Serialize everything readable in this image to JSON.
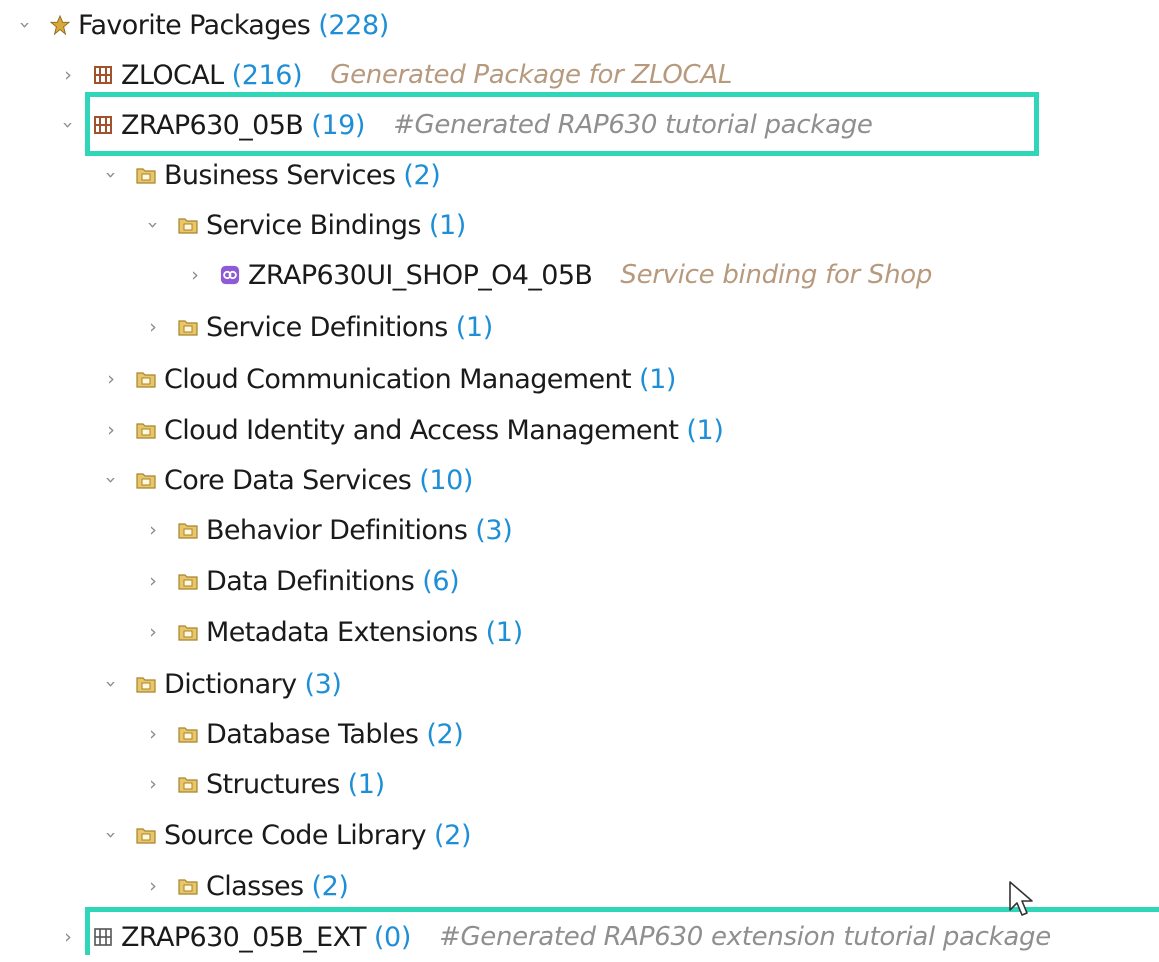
{
  "tree": {
    "root": {
      "label": "Favorite Packages",
      "count": "(228)"
    },
    "zlocal": {
      "label": "ZLOCAL",
      "count": "(216)",
      "desc": "Generated Package for ZLOCAL"
    },
    "zrap": {
      "label": "ZRAP630_05B",
      "count": "(19)",
      "desc": "#Generated RAP630  tutorial package"
    },
    "business_services": {
      "label": "Business Services",
      "count": "(2)"
    },
    "service_bindings": {
      "label": "Service Bindings",
      "count": "(1)"
    },
    "binding_item": {
      "label": "ZRAP630UI_SHOP_O4_05B",
      "desc": "Service binding for Shop"
    },
    "service_definitions": {
      "label": "Service Definitions",
      "count": "(1)"
    },
    "cloud_comm": {
      "label": "Cloud Communication Management",
      "count": "(1)"
    },
    "cloud_identity": {
      "label": "Cloud Identity and Access Management",
      "count": "(1)"
    },
    "cds": {
      "label": "Core Data Services",
      "count": "(10)"
    },
    "behavior_defs": {
      "label": "Behavior Definitions",
      "count": "(3)"
    },
    "data_defs": {
      "label": "Data Definitions",
      "count": "(6)"
    },
    "metadata_ext": {
      "label": "Metadata Extensions",
      "count": "(1)"
    },
    "dictionary": {
      "label": "Dictionary",
      "count": "(3)"
    },
    "db_tables": {
      "label": "Database Tables",
      "count": "(2)"
    },
    "structures": {
      "label": "Structures",
      "count": "(1)"
    },
    "source_lib": {
      "label": "Source Code Library",
      "count": "(2)"
    },
    "classes": {
      "label": "Classes",
      "count": "(2)"
    },
    "zrap_ext": {
      "label": "ZRAP630_05B_EXT",
      "count": "(0)",
      "desc": "#Generated RAP630  extension tutorial package"
    }
  },
  "colors": {
    "highlight": "#2fd6b8",
    "count": "#1e8fd6",
    "description": "#b79a7e",
    "package_icon": "#a0522d",
    "folder_icon": "#d8a93a",
    "binding_icon": "#8e5bd6"
  },
  "icons": {
    "root": "favorites-package-icon",
    "package": "package-icon",
    "folder": "folder-icon",
    "binding": "service-binding-icon",
    "twisty_closed": "chevron-right-icon",
    "twisty_open": "chevron-down-icon",
    "cursor": "mouse-cursor-icon"
  }
}
